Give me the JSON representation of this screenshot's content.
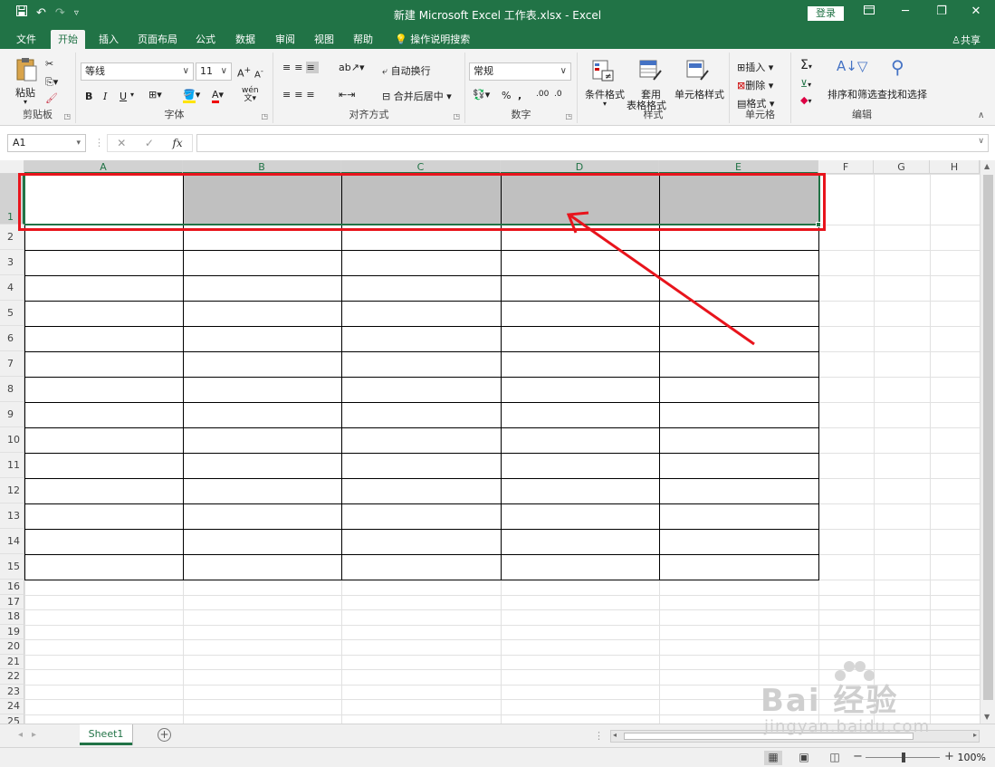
{
  "titlebar": {
    "title": "新建 Microsoft Excel 工作表.xlsx - Excel",
    "login_label": "登录",
    "qat": {
      "save_icon": "save-icon",
      "undo_icon": "undo-icon",
      "redo_icon": "redo-icon",
      "customize_icon": "customize-qat-icon"
    }
  },
  "tabs": [
    {
      "label": "文件"
    },
    {
      "label": "开始"
    },
    {
      "label": "插入"
    },
    {
      "label": "页面布局"
    },
    {
      "label": "公式"
    },
    {
      "label": "数据"
    },
    {
      "label": "审阅"
    },
    {
      "label": "视图"
    },
    {
      "label": "帮助"
    }
  ],
  "tell_me": "操作说明搜索",
  "share_label": "共享",
  "ribbon": {
    "clipboard": {
      "paste": "粘贴",
      "group": "剪贴板"
    },
    "font": {
      "name": "等线",
      "size": "11",
      "group": "字体",
      "bold": "B",
      "italic": "I",
      "underline": "U",
      "wen": "wén"
    },
    "alignment": {
      "wrap": "自动换行",
      "merge": "合并后居中",
      "group": "对齐方式"
    },
    "number": {
      "format": "常规",
      "percent": "%",
      "comma": ",",
      "group": "数字"
    },
    "styles": {
      "conditional": "条件格式",
      "table1": "套用",
      "table2": "表格格式",
      "cell": "单元格样式",
      "group": "样式"
    },
    "cells": {
      "insert": "插入",
      "delete": "删除",
      "format": "格式",
      "group": "单元格"
    },
    "editing": {
      "sort": "排序和筛选",
      "find": "查找和选择",
      "group": "编辑"
    }
  },
  "formula_bar": {
    "name_box": "A1",
    "fx": "fx",
    "cancel": "✕",
    "enter": "✓",
    "value": ""
  },
  "columns": [
    "A",
    "B",
    "C",
    "D",
    "E",
    "F",
    "G",
    "H"
  ],
  "rows": [
    "1",
    "2",
    "3",
    "4",
    "5",
    "6",
    "7",
    "8",
    "9",
    "10",
    "11",
    "12",
    "13",
    "14",
    "15",
    "16",
    "17",
    "18",
    "19",
    "20",
    "21",
    "22",
    "23",
    "24",
    "25"
  ],
  "sheet_tab": "Sheet1",
  "add_sheet": "+",
  "status": {
    "zoom": "100%"
  },
  "accent_color": "#217346",
  "annotation_color": "#e8141c",
  "watermark": {
    "big": "Bai 经验",
    "small": "jingyan.baidu.com"
  }
}
